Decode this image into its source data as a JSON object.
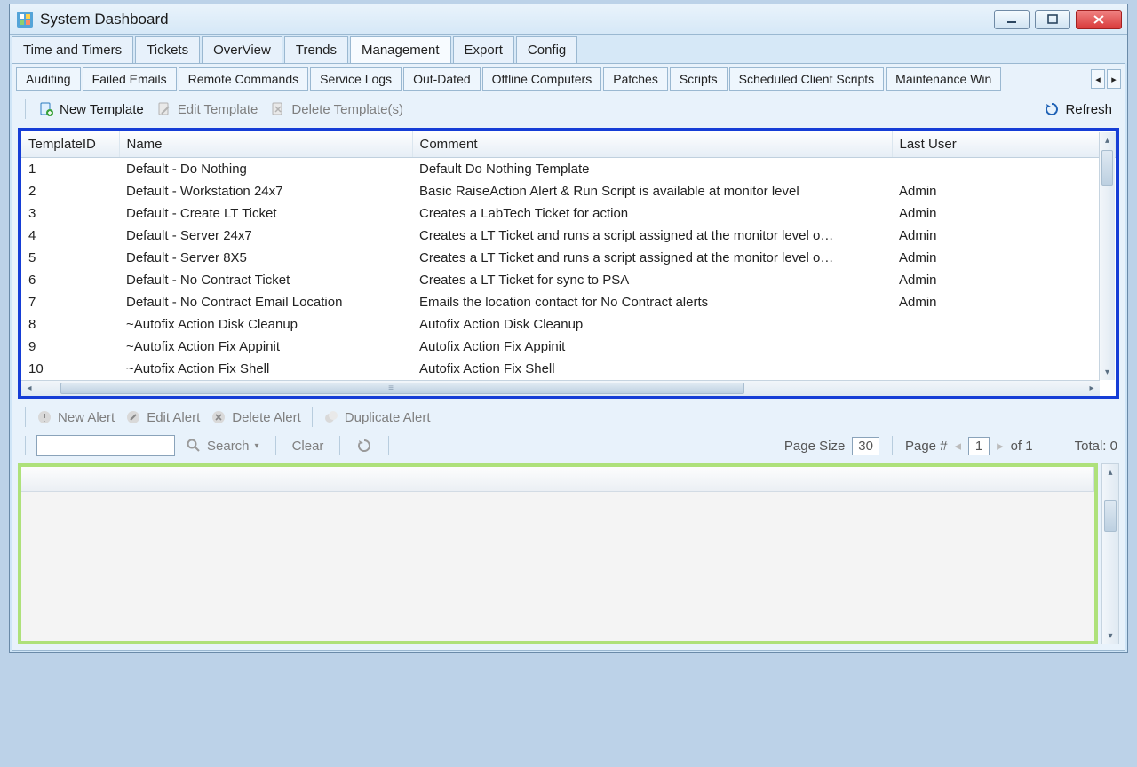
{
  "window": {
    "title": "System Dashboard"
  },
  "tabs": {
    "items": [
      "Time and Timers",
      "Tickets",
      "OverView",
      "Trends",
      "Management",
      "Export",
      "Config"
    ],
    "active": 4
  },
  "subtabs": {
    "items": [
      "Auditing",
      "Failed Emails",
      "Remote Commands",
      "Service Logs",
      "Out-Dated",
      "Offline Computers",
      "Patches",
      "Scripts",
      "Scheduled Client Scripts",
      "Maintenance Win"
    ],
    "active": -1
  },
  "template_toolbar": {
    "new_label": "New Template",
    "edit_label": "Edit Template",
    "delete_label": "Delete Template(s)",
    "refresh_label": "Refresh",
    "edit_enabled": false,
    "delete_enabled": false
  },
  "grid": {
    "columns": [
      "TemplateID",
      "Name",
      "Comment",
      "Last User"
    ],
    "rows": [
      {
        "id": "1",
        "name": "Default - Do Nothing",
        "comment": "Default Do Nothing Template",
        "last_user": ""
      },
      {
        "id": "2",
        "name": "Default - Workstation 24x7",
        "comment": "Basic RaiseAction Alert & Run Script is available at monitor level",
        "last_user": "Admin"
      },
      {
        "id": "3",
        "name": "Default - Create LT Ticket",
        "comment": "Creates a LabTech Ticket for action",
        "last_user": "Admin"
      },
      {
        "id": "4",
        "name": "Default - Server 24x7",
        "comment": "Creates a LT Ticket and runs a script assigned at the monitor level o…",
        "last_user": "Admin"
      },
      {
        "id": "5",
        "name": "Default - Server 8X5",
        "comment": "Creates a LT Ticket and runs a script assigned at the monitor level o…",
        "last_user": "Admin"
      },
      {
        "id": "6",
        "name": "Default - No Contract Ticket",
        "comment": "Creates a LT Ticket for sync to PSA",
        "last_user": "Admin"
      },
      {
        "id": "7",
        "name": "Default - No Contract Email Location",
        "comment": "Emails the location contact for No Contract alerts",
        "last_user": "Admin"
      },
      {
        "id": "8",
        "name": "~Autofix Action Disk Cleanup",
        "comment": "Autofix Action Disk Cleanup",
        "last_user": ""
      },
      {
        "id": "9",
        "name": "~Autofix Action Fix Appinit",
        "comment": "Autofix Action Fix Appinit",
        "last_user": ""
      },
      {
        "id": "10",
        "name": "~Autofix Action Fix Shell",
        "comment": "Autofix Action Fix Shell",
        "last_user": ""
      }
    ]
  },
  "alert_toolbar": {
    "new_label": "New Alert",
    "edit_label": "Edit Alert",
    "delete_label": "Delete Alert",
    "duplicate_label": "Duplicate Alert"
  },
  "search_bar": {
    "search_label": "Search",
    "clear_label": "Clear",
    "input_value": ""
  },
  "pager": {
    "page_size_label": "Page Size",
    "page_size": "30",
    "page_num_label": "Page #",
    "page_num": "1",
    "of_label": "of 1",
    "total_label": "Total: 0"
  }
}
